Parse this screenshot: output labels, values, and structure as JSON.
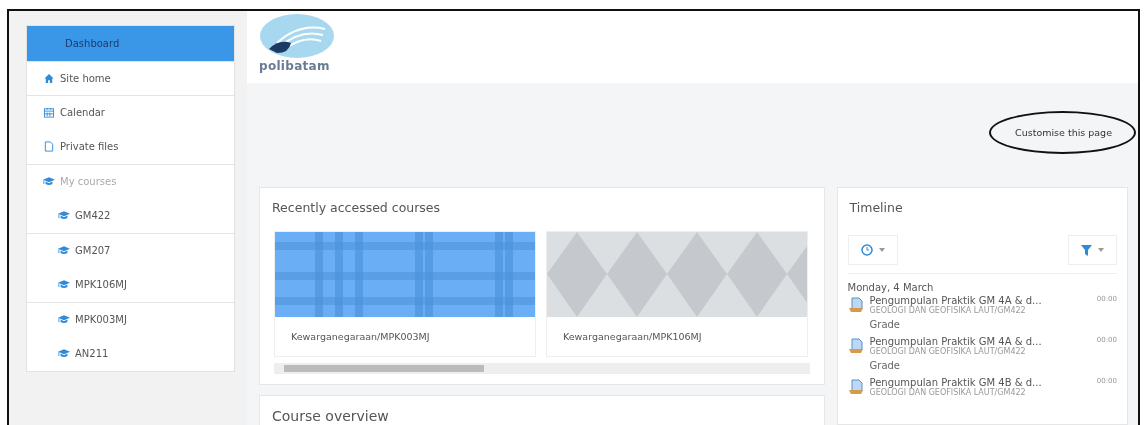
{
  "sidebar": {
    "items": [
      {
        "label": "Dashboard",
        "kind": "plain",
        "selected": true,
        "disabled": false,
        "group_start": true
      },
      {
        "label": "Site home",
        "kind": "home",
        "selected": false,
        "disabled": false,
        "group_start": true
      },
      {
        "label": "Calendar",
        "kind": "calendar",
        "selected": false,
        "disabled": false,
        "group_start": true
      },
      {
        "label": "Private files",
        "kind": "file",
        "selected": false,
        "disabled": false,
        "group_start": false
      },
      {
        "label": "My courses",
        "kind": "course",
        "selected": false,
        "disabled": true,
        "group_start": true,
        "children": [
          {
            "label": "GM422",
            "kind": "course",
            "selected": false,
            "disabled": false,
            "group_start": false
          },
          {
            "label": "GM207",
            "kind": "course",
            "selected": false,
            "disabled": false,
            "group_start": true
          },
          {
            "label": "MPK106MJ",
            "kind": "course",
            "selected": false,
            "disabled": false,
            "group_start": false
          },
          {
            "label": "MPK003MJ",
            "kind": "course",
            "selected": false,
            "disabled": false,
            "group_start": true
          },
          {
            "label": "AN211",
            "kind": "course",
            "selected": false,
            "disabled": false,
            "group_start": false
          }
        ]
      }
    ]
  },
  "logo": {
    "text": "polibatam"
  },
  "customise_button": {
    "label": "Customise this page",
    "circled": true
  },
  "recent": {
    "title": "Recently accessed courses",
    "courses": [
      {
        "name": "Kewarganegaraan/MPK003MJ",
        "kind": "plaid"
      },
      {
        "name": "Kewarganegaraan/MPK106MJ",
        "kind": "diamonds"
      }
    ]
  },
  "course_overview": {
    "title": "Course overview"
  },
  "timeline": {
    "title": "Timeline",
    "date": "Monday, 4 March",
    "events": [
      {
        "title": "Pengumpulan Praktik GM 4A & d...",
        "time": "00:00",
        "course": "GEOLOGI DAN GEOFISIKA LAUT/GM422",
        "action": "Grade"
      },
      {
        "title": "Pengumpulan Praktik GM 4A & d...",
        "time": "00:00",
        "course": "GEOLOGI DAN GEOFISIKA LAUT/GM422",
        "action": "Grade"
      },
      {
        "title": "Pengumpulan Praktik GM 4B & d...",
        "time": "00:00",
        "course": "GEOLOGI DAN GEOFISIKA LAUT/GM422"
      }
    ]
  }
}
